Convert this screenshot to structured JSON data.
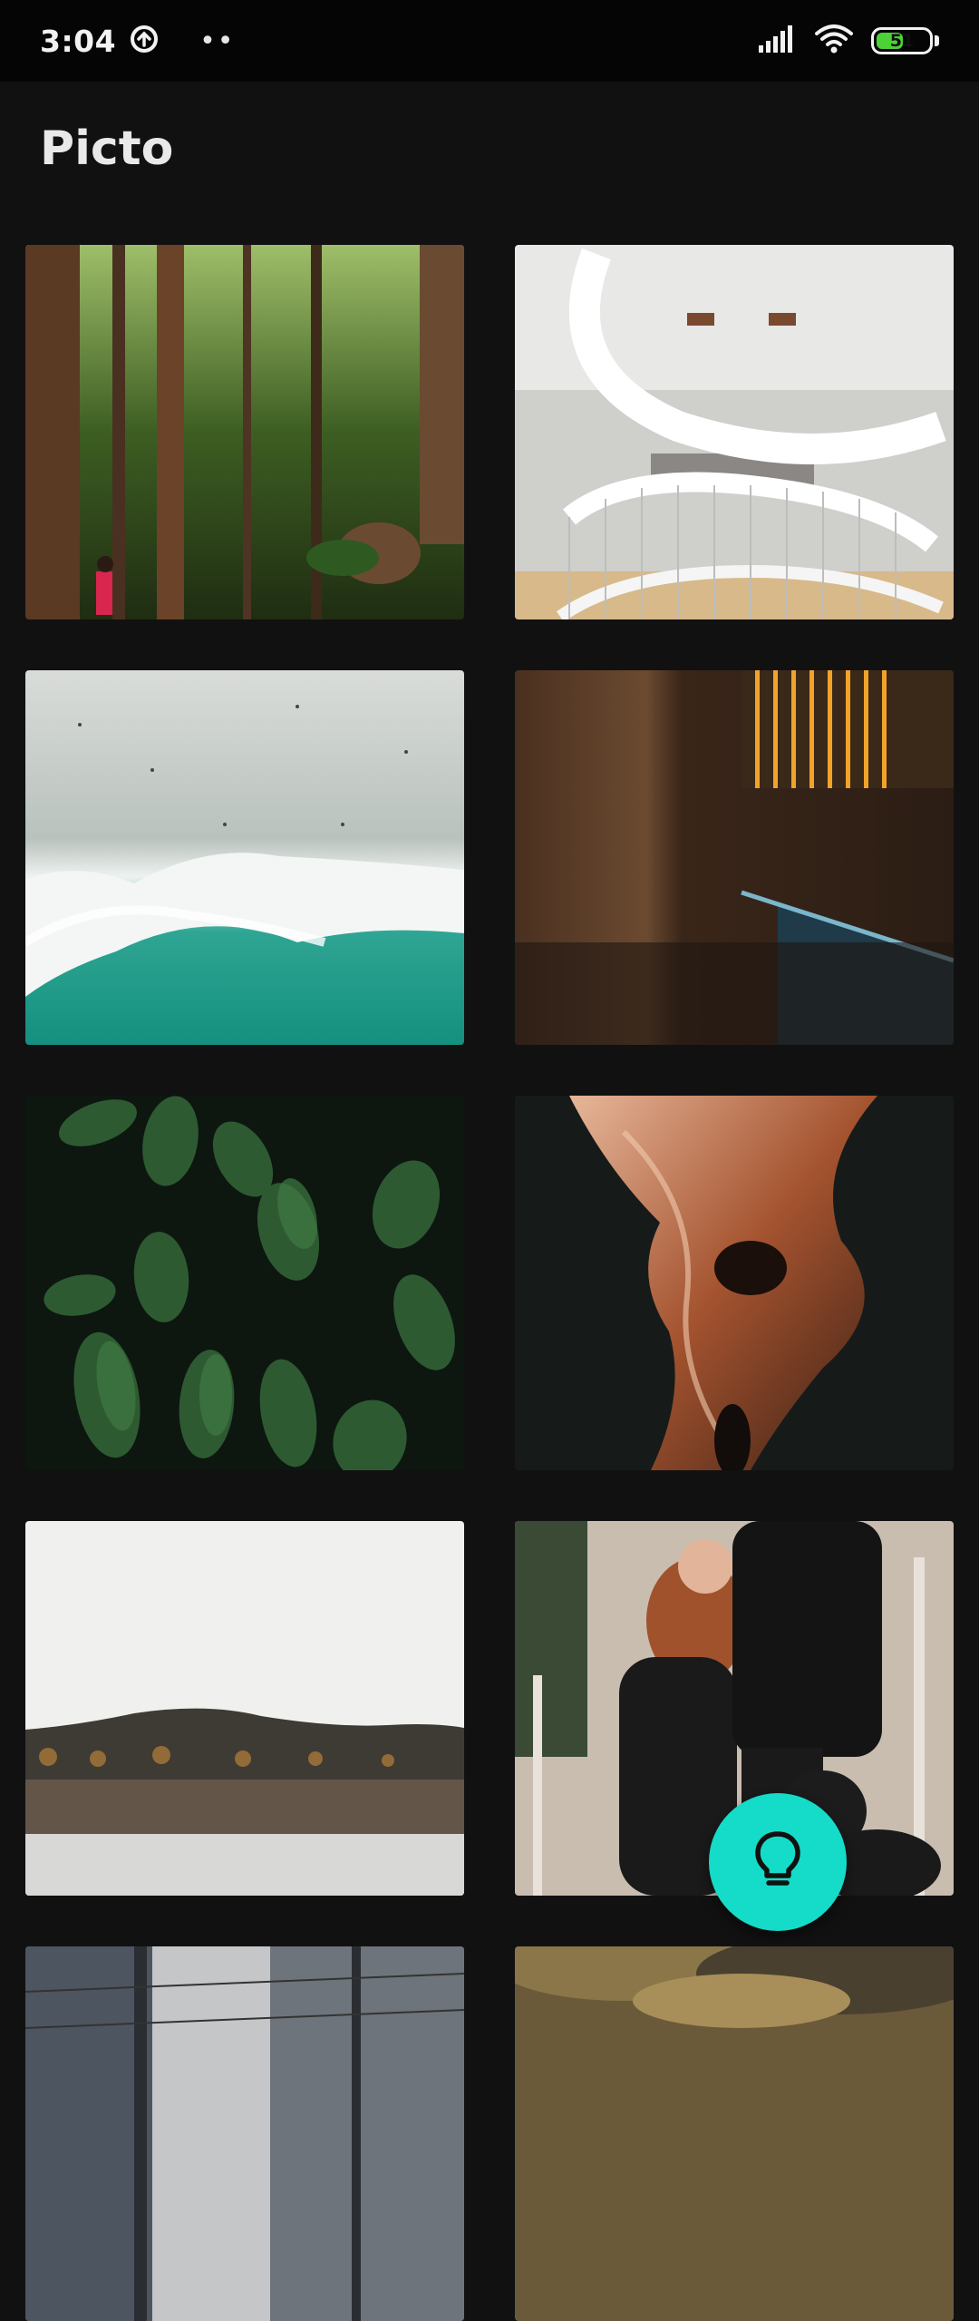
{
  "status_bar": {
    "time": "3:04",
    "notification_dots": "••",
    "battery_level": "51",
    "battery_fraction": 0.51,
    "icons": [
      "data-saver-icon",
      "signal-icon",
      "wifi-icon",
      "battery-icon"
    ]
  },
  "app": {
    "title": "Picto"
  },
  "gallery": {
    "images": [
      {
        "subject": "forest-with-hiker"
      },
      {
        "subject": "spiral-staircase-library"
      },
      {
        "subject": "aerial-ocean-waves"
      },
      {
        "subject": "wooden-wall-interior"
      },
      {
        "subject": "green-leaves"
      },
      {
        "subject": "slot-canyon"
      },
      {
        "subject": "lake-forest-reflection"
      },
      {
        "subject": "couple-with-dog"
      },
      {
        "subject": "city-building"
      },
      {
        "subject": "rocky-shore"
      }
    ]
  },
  "fab": {
    "icon": "lightbulb-icon",
    "color": "#14dcc8"
  }
}
